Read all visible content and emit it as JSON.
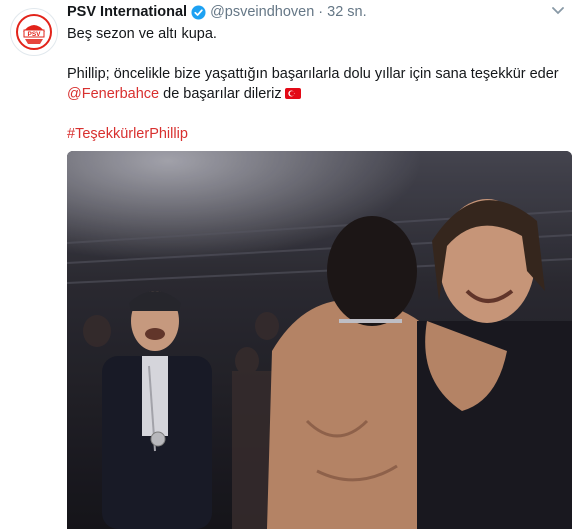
{
  "account": {
    "name": "PSV International",
    "handle": "@psveindhoven",
    "separator": "·",
    "time": "32 sn.",
    "avatar_icon": "psv-logo-icon",
    "verified_icon": "verified-badge-icon"
  },
  "tweet": {
    "line1": "Beş sezon ve altı kupa.",
    "line2": "Phillip; öncelikle bize yaşattığın başarılarla dolu yıllar için sana teşekkür eder",
    "mention": "@Fenerbahce",
    "line3_rest": " de başarılar dileriz",
    "flag_icon": "turkey-flag-icon",
    "hashtag": "#TeşekkürlerPhillip"
  },
  "media": {
    "type": "video-still",
    "description_icon": "celebration-photo"
  },
  "colors": {
    "link": "#d8302f",
    "verified": "#1da1f2",
    "secondary_text": "#657786",
    "psv_red": "#e2231a"
  }
}
